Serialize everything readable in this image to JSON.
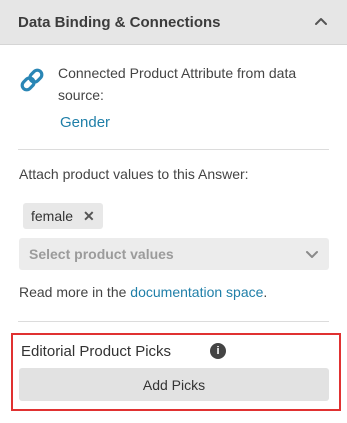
{
  "header": {
    "title": "Data Binding & Connections",
    "collapse_icon": "chevron-up-icon"
  },
  "connection": {
    "icon": "link-icon",
    "description": "Connected Product Attribute from data source:",
    "attribute": "Gender"
  },
  "attach": {
    "label": "Attach product values to this Answer:",
    "chips": [
      {
        "label": "female",
        "remove_icon": "close-icon",
        "remove_glyph": "✕"
      }
    ],
    "select_placeholder": "Select product values",
    "select_icon": "chevron-down-icon"
  },
  "readmore": {
    "prefix": "Read more in the ",
    "link": "documentation space",
    "suffix": "."
  },
  "editorial": {
    "title": "Editorial Product Picks",
    "info_icon": "info-icon",
    "info_glyph": "i",
    "button_label": "Add Picks"
  },
  "colors": {
    "accent_link": "#1f7fa8",
    "highlight_border": "#e03131",
    "header_bg": "#e6e6e6"
  }
}
